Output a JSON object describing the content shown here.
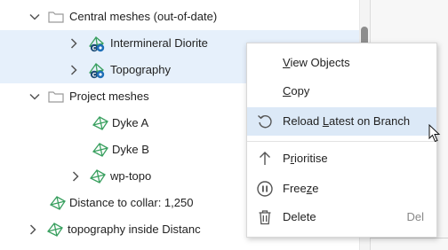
{
  "tree": {
    "rows": [
      {
        "label": "Central meshes (out-of-date)"
      },
      {
        "label": "Intermineral Diorite"
      },
      {
        "label": "Topography"
      },
      {
        "label": "Project meshes"
      },
      {
        "label": "Dyke A"
      },
      {
        "label": "Dyke B"
      },
      {
        "label": "wp-topo"
      },
      {
        "label": "Distance to collar: 1,250"
      },
      {
        "label": "topography inside Distanc"
      }
    ]
  },
  "context_menu": {
    "view_objects": {
      "mnemonic": "V",
      "rest": "iew Objects"
    },
    "copy": {
      "mnemonic": "C",
      "rest": "opy"
    },
    "reload": {
      "pre": "Reload ",
      "mnemonic": "L",
      "rest": "atest on Branch"
    },
    "prioritise": {
      "pre": "P",
      "mnemonic": "r",
      "rest": "ioritise"
    },
    "freeze": {
      "pre": "Free",
      "mnemonic": "z",
      "rest": "e"
    },
    "delete": {
      "label": "Delete",
      "shortcut": "Del"
    }
  },
  "colors": {
    "selection": "#e6f0fb",
    "menu_highlight": "#dce9f7",
    "mesh_icon_green": "#3aa060",
    "central_badge_blue": "#1e6fb8",
    "folder_outline": "#9a9a9a"
  },
  "icons": {
    "expand": "chevron-down-icon",
    "collapse": "chevron-right-icon",
    "folder": "folder-icon",
    "mesh": "mesh-icon",
    "central_mesh": "central-mesh-icon",
    "reload": "reload-icon",
    "prioritise": "arrow-up-icon",
    "freeze": "pause-circle-icon",
    "delete": "trash-icon",
    "cursor": "mouse-cursor-icon"
  }
}
